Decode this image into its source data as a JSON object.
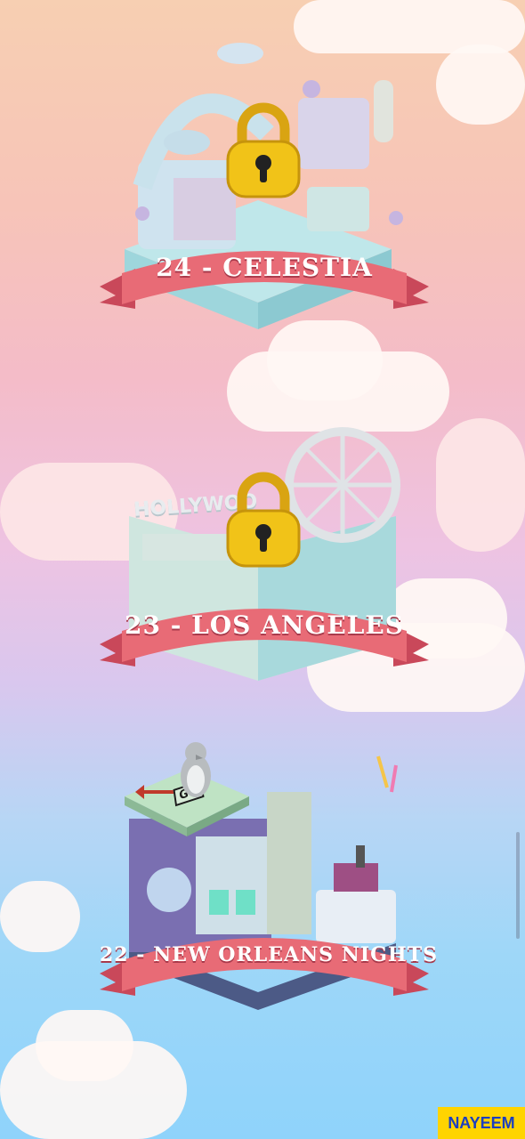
{
  "levels": [
    {
      "label": "24 - CELESTIA",
      "locked": true
    },
    {
      "label": "23 - LOS ANGELES",
      "locked": true
    },
    {
      "label": "22 - NEW ORLEANS NIGHTS",
      "locked": false
    }
  ],
  "scenery_text": {
    "hollywood_sign": "HOLLYWOO",
    "board_tile": "GO"
  },
  "watermark": "NAYEEM",
  "colors": {
    "ribbon": "#e86b76",
    "lock_gold": "#f1c318",
    "badge_bg": "#ffd400",
    "badge_text": "#1b3fc0"
  }
}
